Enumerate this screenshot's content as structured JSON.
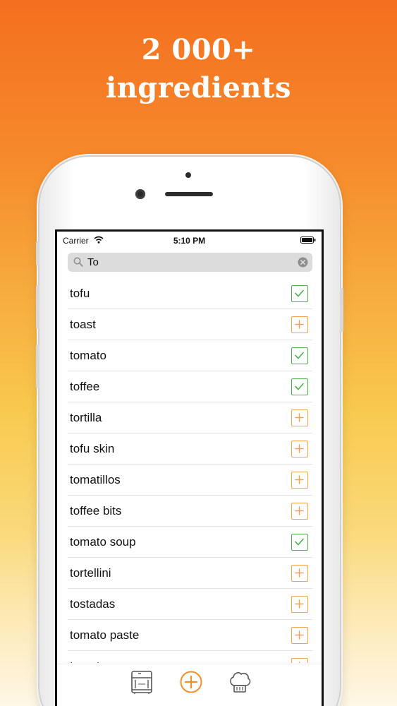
{
  "headline": {
    "line1": "2 000+",
    "line2": "ingredients"
  },
  "status_bar": {
    "carrier": "Carrier",
    "time": "5:10 PM"
  },
  "search": {
    "value": "To"
  },
  "ingredients": [
    {
      "name": "tofu",
      "state": "checked"
    },
    {
      "name": "toast",
      "state": "add"
    },
    {
      "name": "tomato",
      "state": "checked"
    },
    {
      "name": "toffee",
      "state": "checked"
    },
    {
      "name": "tortilla",
      "state": "add"
    },
    {
      "name": "tofu skin",
      "state": "add"
    },
    {
      "name": "tomatillos",
      "state": "add"
    },
    {
      "name": "toffee bits",
      "state": "add"
    },
    {
      "name": "tomato soup",
      "state": "checked"
    },
    {
      "name": "tortellini",
      "state": "add"
    },
    {
      "name": "tostadas",
      "state": "add"
    },
    {
      "name": "tomato paste",
      "state": "add"
    },
    {
      "name": "tomato sauce",
      "state": "add"
    }
  ],
  "tab_bar": {
    "tabs": [
      {
        "icon": "fridge-icon"
      },
      {
        "icon": "add-circle-icon"
      },
      {
        "icon": "chef-hat-icon"
      }
    ]
  },
  "colors": {
    "accent": "#f0902f",
    "checked": "#4caf50",
    "add": "#f3a24a",
    "gradient_top": "#f46f1f",
    "gradient_bottom": "#fef7e6"
  }
}
